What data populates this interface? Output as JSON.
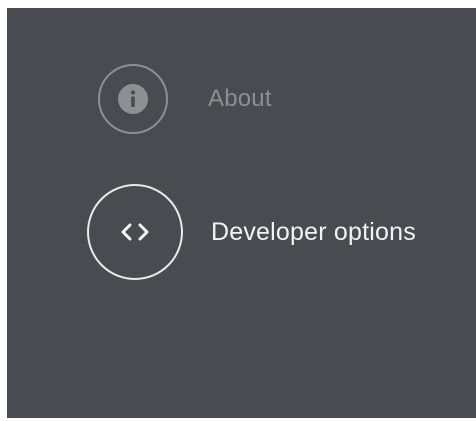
{
  "menu": {
    "items": [
      {
        "label": "About",
        "icon": "info-icon",
        "selected": false
      },
      {
        "label": "Developer options",
        "icon": "code-icon",
        "selected": true
      }
    ]
  },
  "colors": {
    "background": "#4a4b50",
    "dimmed_text": "#8d8e92",
    "active_text": "#f2f2f2"
  }
}
